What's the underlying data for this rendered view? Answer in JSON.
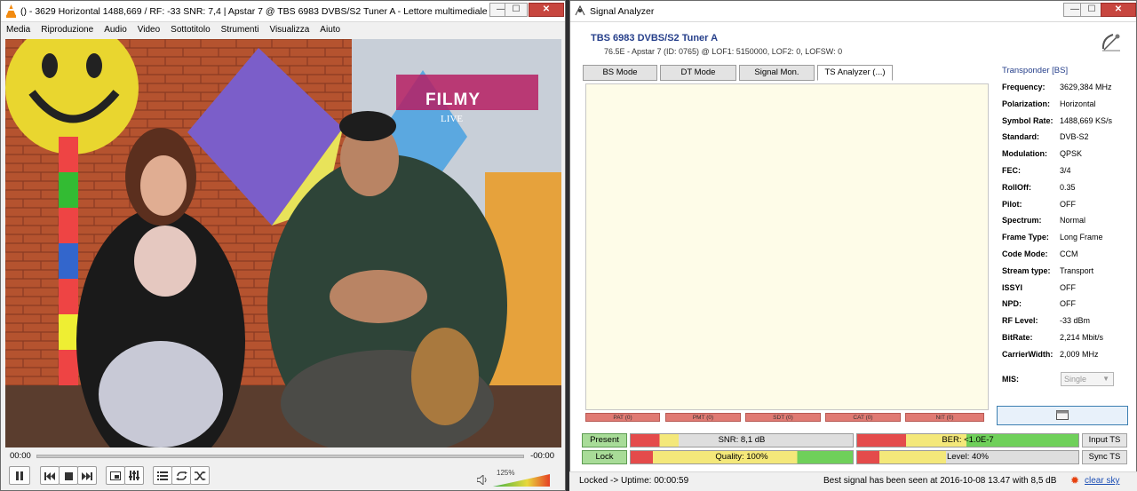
{
  "vlc": {
    "title": "() - 3629 Horizontal 1488,669 / RF: -33 SNR: 7,4 | Apstar 7 @ TBS 6983 DVBS/S2 Tuner A - Lettore multimediale VLC",
    "window_controls": {
      "minimize": "—",
      "maximize": "☐",
      "close": "✕"
    },
    "menu": [
      "Media",
      "Riproduzione",
      "Audio",
      "Video",
      "Sottotitolo",
      "Strumenti",
      "Visualizza",
      "Aiuto"
    ],
    "video": {
      "logo_text": "FILMY",
      "logo_sub": "LIVE"
    },
    "time_elapsed": "00:00",
    "time_remaining": "-00:00",
    "volume": "125%",
    "volume_level": 1.0,
    "icons": {
      "pause": "pause-icon",
      "prev": "previous-icon",
      "stop": "stop-icon",
      "next": "next-icon",
      "fullscreen": "fullscreen-icon",
      "settings": "extended-settings-icon",
      "playlist": "playlist-icon",
      "loop": "loop-icon",
      "shuffle": "shuffle-icon",
      "speaker": "speaker-icon"
    }
  },
  "sa": {
    "title": "Signal Analyzer",
    "window_controls": {
      "minimize": "—",
      "maximize": "☐",
      "close": "✕"
    },
    "tuner_name": "TBS 6983 DVBS/S2 Tuner A",
    "tuner_info": "76.5E - Apstar 7 (ID: 0765) @ LOF1: 5150000, LOF2: 0, LOFSW: 0",
    "tabs": [
      "BS Mode",
      "DT Mode",
      "Signal Mon.",
      "TS Analyzer (...)"
    ],
    "pid_tables": [
      "PAT (0)",
      "PMT (0)",
      "SDT (0)",
      "CAT (0)",
      "NIT (0)"
    ],
    "transponder_header": "Transponder [BS]",
    "properties": [
      {
        "k": "Frequency:",
        "v": "3629,384 MHz"
      },
      {
        "k": "Polarization:",
        "v": "Horizontal"
      },
      {
        "k": "Symbol Rate:",
        "v": "1488,669 KS/s"
      },
      {
        "k": "Standard:",
        "v": "DVB-S2"
      },
      {
        "k": "Modulation:",
        "v": "QPSK"
      },
      {
        "k": "FEC:",
        "v": "3/4"
      },
      {
        "k": "RollOff:",
        "v": "0.35"
      },
      {
        "k": "Pilot:",
        "v": "OFF"
      },
      {
        "k": "Spectrum:",
        "v": "Normal"
      },
      {
        "k": "Frame Type:",
        "v": "Long Frame"
      },
      {
        "k": "Code Mode:",
        "v": "CCM"
      },
      {
        "k": "Stream type:",
        "v": "Transport"
      },
      {
        "k": "ISSYI",
        "v": "OFF"
      },
      {
        "k": "NPD:",
        "v": "OFF"
      },
      {
        "k": "RF Level:",
        "v": "-33 dBm"
      },
      {
        "k": "BitRate:",
        "v": "2,214 Mbit/s"
      },
      {
        "k": "CarrierWidth:",
        "v": "2,009 MHz"
      }
    ],
    "mis_label": "MIS:",
    "mis_value": "Single",
    "present_label": "Present",
    "lock_label": "Lock",
    "snr_label": "SNR: 8,1 dB",
    "snr_level": 0.08,
    "quality_label": "Quality: 100%",
    "quality_level": 1.0,
    "ber_label": "BER: <1.0E-7",
    "ber_level": 0.22,
    "level_label": "Level: 40%",
    "level_level": 0.4,
    "input_ts_label": "Input TS",
    "sync_ts_label": "Sync TS",
    "status_left": "Locked -> Uptime: 00:00:59",
    "status_mid": "Best signal has been seen at 2016-10-08 13.47 with 8,5 dB",
    "status_right": "clear sky",
    "colors": {
      "accent_blue": "#27408b",
      "pid_red": "#e07a73",
      "ok_green": "#6fd05a",
      "warn_yellow": "#f4e87a",
      "bad_red": "#e44b4b"
    }
  }
}
